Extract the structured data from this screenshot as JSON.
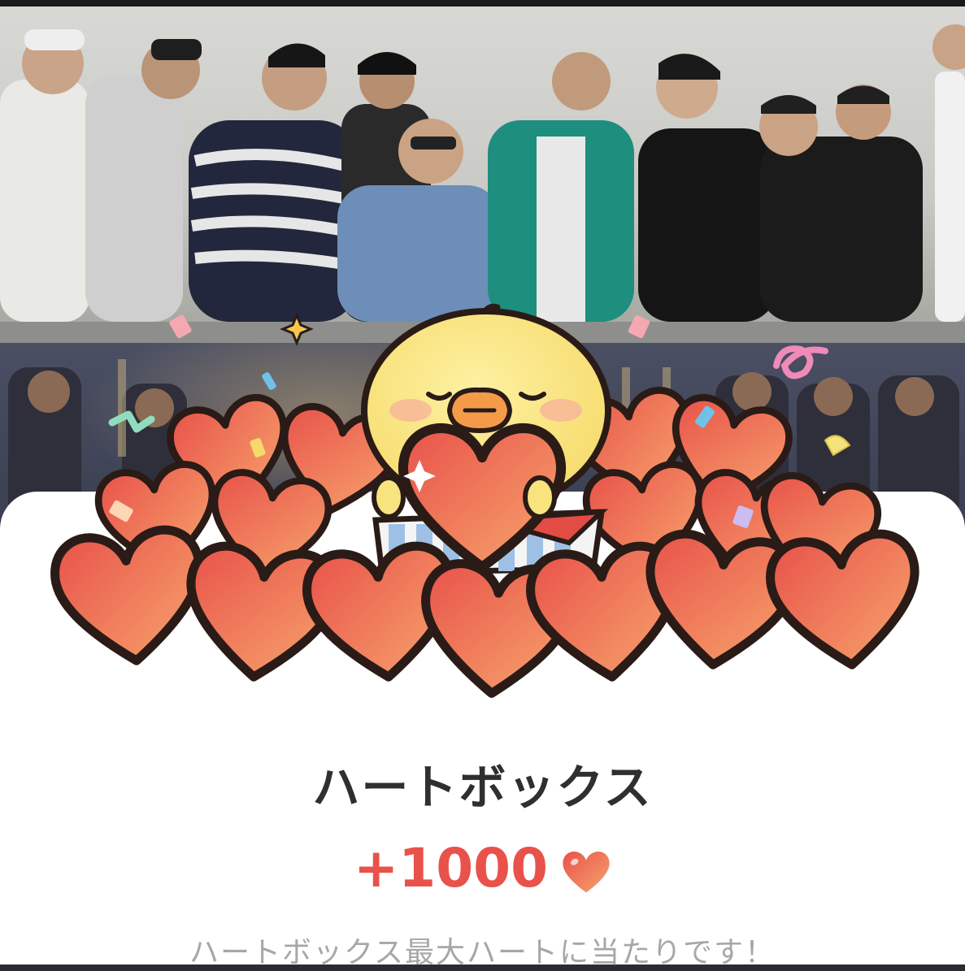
{
  "dialog": {
    "title": "ハートボックス",
    "reward_amount": "+1000",
    "reward_icon": "heart-icon",
    "message": "ハートボックス最大ハートに当たりです！"
  },
  "colors": {
    "accent": "#e8524a",
    "title": "#2f2f2f",
    "message": "#a7a7a7",
    "heart_light": "#f6a06c",
    "heart_dark": "#e8524a",
    "chick": "#f9e37f"
  }
}
